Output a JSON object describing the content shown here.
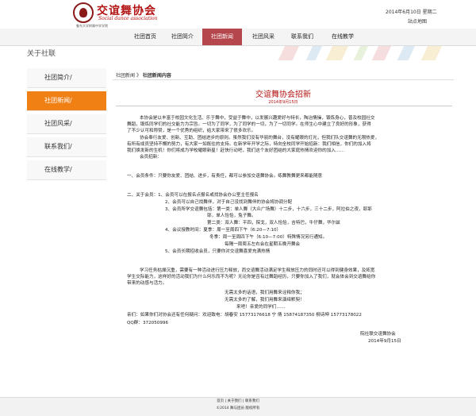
{
  "header": {
    "logo_cn": "交谊舞协会",
    "logo_en": "Social dance association",
    "logo_sub": "鲁东大学附属中学学院",
    "date": "2014年6月10日 星期二",
    "sitemap": "站点地图"
  },
  "nav": {
    "items": [
      {
        "label": "社团首页"
      },
      {
        "label": "社团简介"
      },
      {
        "label": "社团新闻"
      },
      {
        "label": "社团风采"
      },
      {
        "label": "联系我们"
      },
      {
        "label": "在线教学"
      }
    ]
  },
  "colors": {
    "nav_active": "#b5464b",
    "side_active": "#f07f14",
    "title": "#b31212"
  },
  "about_label": "关于社联",
  "sidebar": {
    "items": [
      {
        "label": "社团简介/"
      },
      {
        "label": "社团新闻/"
      },
      {
        "label": "社团风采/"
      },
      {
        "label": "联系我们/"
      },
      {
        "label": "在线教学/"
      }
    ]
  },
  "content": {
    "breadcrumb_parent": "社团新闻",
    "breadcrumb_sep": "》",
    "breadcrumb_current": "社团新闻内容",
    "title": "交谊舞协会招新",
    "date": "2014年9月15日",
    "lines": [
      "本协会是以丰富于校园文化生活、乐于舞中，受益于舞中，以发展兴趣爱好与特长，陶冶情操，锻炼身心，普及校园社交",
      "舞蹈，锻炼同学们的社交能力为宗旨。一切为了同学，为了同学的一切，为了一切同学。在师生心中建立了良好的形象，获得",
      "了不少认可和称赞，是一个优秀的组织，给大家带来了很多欢乐。",
      "协会奉行友爱、创新、互助、团结进步的原则。虽然我们没有华丽的舞台，没有耀眼的灯光，但我们队交谊舞的无限热爱，",
      "有所有成员坚持不懈的努力，有大家一如既往的支持。在新学年开学之际，特向全校同学开始招新：我们相信，你们的加入将",
      "我们焕发新的生机！你们将成为学校耀眼新星！赶快行动吧，我们这个友好团结的大家庭热情欢迎你的加入……",
      "会员招新：",
      "一、会员条件：只要你友爱、团结、进步，有责任，都可以参加交谊舞协会。练舞教舞更来都能随意",
      "二、关于会员：1、会员可以在报名点报名或找协会办公室主任报名",
      "2、会员可以自己找舞伴，对于自己没找到舞伴的协会将协调分配",
      "3、会员所学交谊舞包括：第一类：单人舞（大众广场舞）十二步，十六步，三十二步，阿拉伯之夜，耶耶",
      "耶，单人恰恰，兔子舞。",
      "第二类：双人舞：平四，探戈，双人恰恰，吉特巴，牛仔舞，华尔兹",
      "4、会议授教时间：夏季：周一至周四下午（6:20—7:10）",
      "冬季：周一至周四下午（6:10—7:00）特殊情况另行通知。",
      "每隔一周周五左右会在星期五晚开舞会",
      "5、会员长期招收会员，只要你对交谊舞喜爱充满热情",
      "学习任务枯燥沉重，需要有一种活动进行压力释放，而交谊舞活动满足学生释放压力的同时还可以得到健身效果，及拓宽",
      "学生交际能力，这样好的活动我们为什么何乐而不为呢？无论你是否有过舞蹈经历，只要你加入了我们，就会体会到交谊舞给你",
      "带来的动感与活力。",
      "无需太多的话语，我们用舞来诠释你我；",
      "无需太多的了解，我们用舞来演绎默契！",
      "来吧！亲爱的同学们……",
      "亲们：如果你们对协会还有任何疑问：欢迎致电：胡春安 15773176618    宁 倩 15874187350    柳诗坤 15773178022",
      "QQ群：372050996",
      "院社联交谊舞协会",
      "2014年9月15日"
    ]
  },
  "footer": {
    "links": "首页 | 关于我们 | 联系我们",
    "copy": "©2014 舞与团员 版权所有"
  }
}
